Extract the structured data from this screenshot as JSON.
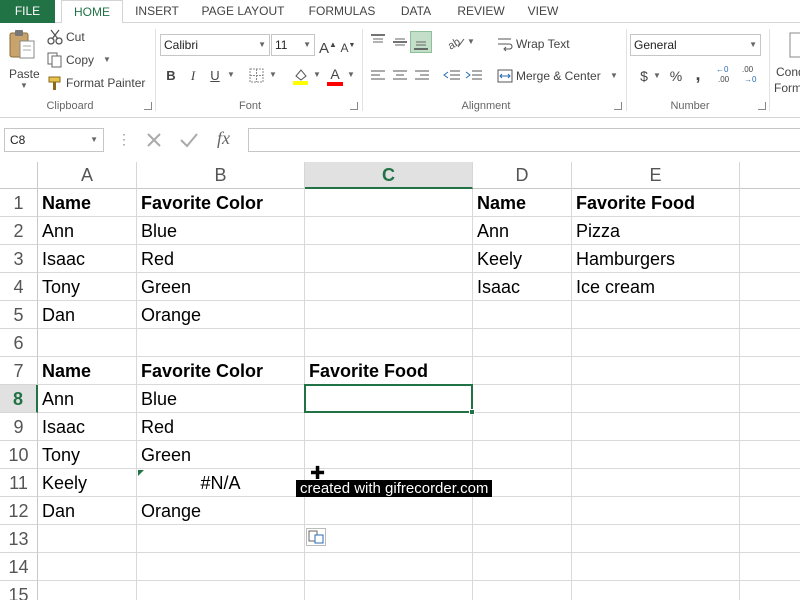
{
  "tabs": {
    "file": "FILE",
    "home": "HOME",
    "insert": "INSERT",
    "page_layout": "PAGE LAYOUT",
    "formulas": "FORMULAS",
    "data": "DATA",
    "review": "REVIEW",
    "view": "VIEW"
  },
  "clipboard": {
    "paste": "Paste",
    "cut": "Cut",
    "copy": "Copy",
    "format_painter": "Format Painter",
    "label": "Clipboard"
  },
  "font": {
    "name": "Calibri",
    "size": "11",
    "bold": "B",
    "italic": "I",
    "underline": "U",
    "label": "Font",
    "grow": "A",
    "shrink": "A",
    "font_color_glyph": "A"
  },
  "alignment": {
    "wrap_text": "Wrap Text",
    "merge_center": "Merge & Center",
    "label": "Alignment"
  },
  "number": {
    "format": "General",
    "currency": "$",
    "percent": "%",
    "comma": ",",
    "inc_decimal": ".00",
    "dec_decimal": ".00",
    "label": "Number"
  },
  "styles": {
    "cond_line1": "Cond",
    "cond_line2": "Form"
  },
  "formula_bar": {
    "name_box": "C8",
    "fx": "fx",
    "value": ""
  },
  "columns": [
    "A",
    "B",
    "C",
    "D",
    "E"
  ],
  "rows": [
    "1",
    "2",
    "3",
    "4",
    "5",
    "6",
    "7",
    "8",
    "9",
    "10",
    "11",
    "12",
    "13",
    "14",
    "15"
  ],
  "cells": {
    "A1": "Name",
    "B1": "Favorite Color",
    "D1": "Name",
    "E1": "Favorite Food",
    "A2": "Ann",
    "B2": "Blue",
    "D2": "Ann",
    "E2": "Pizza",
    "A3": "Isaac",
    "B3": "Red",
    "D3": "Keely",
    "E3": "Hamburgers",
    "A4": "Tony",
    "B4": "Green",
    "D4": "Isaac",
    "E4": "Ice cream",
    "A5": "Dan",
    "B5": "Orange",
    "A7": "Name",
    "B7": "Favorite Color",
    "C7": "Favorite Food",
    "A8": "Ann",
    "B8": "Blue",
    "A9": "Isaac",
    "B9": "Red",
    "A10": "Tony",
    "B10": "Green",
    "A11": "Keely",
    "B11": "#N/A",
    "A12": "Dan",
    "B12": "Orange"
  },
  "selected_cell": "C8",
  "watermark": "created with gifrecorder.com",
  "colors": {
    "excel_green": "#217346",
    "header_selected_bg": "#e1e1e1",
    "highlight_yellow": "#ffff00",
    "font_red": "#ff0000"
  }
}
